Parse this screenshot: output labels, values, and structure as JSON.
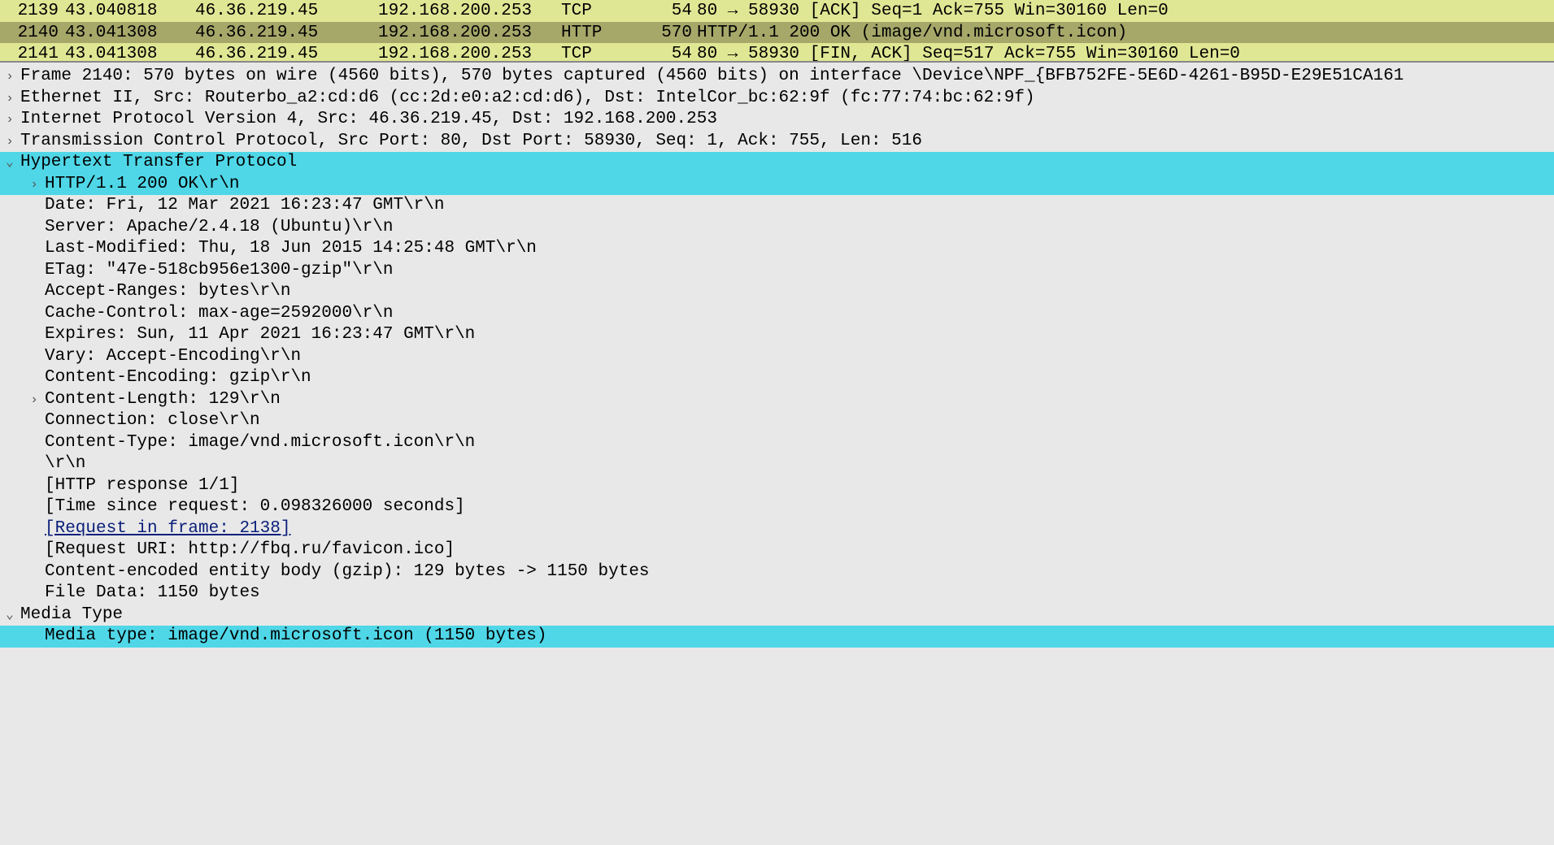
{
  "packets": [
    {
      "no": "2139",
      "time": "43.040818",
      "src": "46.36.219.45",
      "dst": "192.168.200.253",
      "proto": "TCP",
      "len": "54",
      "info": "80 → 58930 [ACK] Seq=1 Ack=755 Win=30160 Len=0",
      "cls": "tcp-row"
    },
    {
      "no": "2140",
      "time": "43.041308",
      "src": "46.36.219.45",
      "dst": "192.168.200.253",
      "proto": "HTTP",
      "len": "570",
      "info": "HTTP/1.1 200 OK  (image/vnd.microsoft.icon)",
      "cls": "http-row selected"
    },
    {
      "no": "2141",
      "time": "43.041308",
      "src": "46.36.219.45",
      "dst": "192.168.200.253",
      "proto": "TCP",
      "len": "54",
      "info": "80 → 58930 [FIN, ACK] Seq=517 Ack=755 Win=30160 Len=0",
      "cls": "tcp-row"
    }
  ],
  "details": {
    "frame": "Frame 2140: 570 bytes on wire (4560 bits), 570 bytes captured (4560 bits) on interface \\Device\\NPF_{BFB752FE-5E6D-4261-B95D-E29E51CA161",
    "eth": "Ethernet II, Src: Routerbo_a2:cd:d6 (cc:2d:e0:a2:cd:d6), Dst: IntelCor_bc:62:9f (fc:77:74:bc:62:9f)",
    "ip": "Internet Protocol Version 4, Src: 46.36.219.45, Dst: 192.168.200.253",
    "tcp": "Transmission Control Protocol, Src Port: 80, Dst Port: 58930, Seq: 1, Ack: 755, Len: 516",
    "http_label": "Hypertext Transfer Protocol",
    "http_status": "HTTP/1.1 200 OK\\r\\n",
    "headers": [
      "Date: Fri, 12 Mar 2021 16:23:47 GMT\\r\\n",
      "Server: Apache/2.4.18 (Ubuntu)\\r\\n",
      "Last-Modified: Thu, 18 Jun 2015 14:25:48 GMT\\r\\n",
      "ETag: \"47e-518cb956e1300-gzip\"\\r\\n",
      "Accept-Ranges: bytes\\r\\n",
      "Cache-Control: max-age=2592000\\r\\n",
      "Expires: Sun, 11 Apr 2021 16:23:47 GMT\\r\\n",
      "Vary: Accept-Encoding\\r\\n",
      "Content-Encoding: gzip\\r\\n"
    ],
    "content_length": "Content-Length: 129\\r\\n",
    "headers2": [
      "Connection: close\\r\\n",
      "Content-Type: image/vnd.microsoft.icon\\r\\n",
      "\\r\\n",
      "[HTTP response 1/1]",
      "[Time since request: 0.098326000 seconds]"
    ],
    "request_frame": "[Request in frame: 2138]",
    "headers3": [
      "[Request URI: http://fbq.ru/favicon.ico]",
      "Content-encoded entity body (gzip): 129 bytes -> 1150 bytes",
      "File Data: 1150 bytes"
    ],
    "media_type_label": "Media Type",
    "media_type_value": "Media type: image/vnd.microsoft.icon (1150 bytes)"
  }
}
